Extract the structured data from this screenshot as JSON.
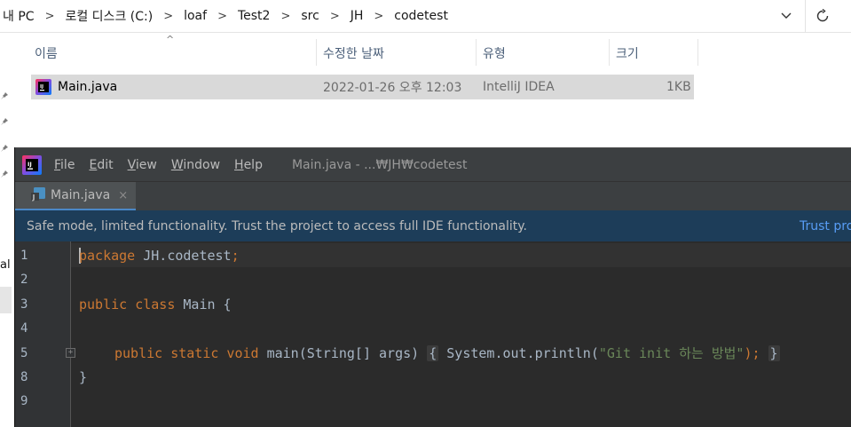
{
  "explorer": {
    "breadcrumbs": [
      "내 PC",
      "로컬 디스크 (C:)",
      "loaf",
      "Test2",
      "src",
      "JH",
      "codetest"
    ],
    "columns": {
      "name": "이름",
      "modified": "수정한 날짜",
      "type": "유형",
      "size": "크기"
    },
    "files": [
      {
        "name": "Main.java",
        "modified": "2022-01-26 오후 12:03",
        "type": "IntelliJ IDEA",
        "size": "1KB"
      }
    ],
    "left_partial_text": "al",
    "icons": {
      "dropdown": "chevron-down-icon",
      "refresh": "refresh-icon",
      "pin": "pin-icon",
      "sort": "sort-up-icon"
    }
  },
  "ide": {
    "menu": {
      "file": {
        "mnemonic": "F",
        "rest": "ile"
      },
      "edit": {
        "mnemonic": "E",
        "rest": "dit"
      },
      "view": {
        "mnemonic": "V",
        "rest": "iew"
      },
      "window": {
        "mnemonic": "W",
        "rest": "indow"
      },
      "help": {
        "mnemonic": "H",
        "rest": "elp"
      }
    },
    "window_title": "Main.java - ...₩JH₩codetest",
    "tab": {
      "label": "Main.java",
      "close": "×"
    },
    "banner": {
      "text": "Safe mode, limited functionality. Trust the project to access full IDE functionality.",
      "link": "Trust pro"
    },
    "editor": {
      "line_numbers": [
        "1",
        "2",
        "3",
        "4",
        "5",
        "8",
        "9"
      ],
      "lines": {
        "l1": {
          "kw": "package",
          "rest": " JH.codetest",
          "semi": ";"
        },
        "l3": {
          "kw": "public class",
          "rest": " Main {"
        },
        "l5": {
          "kw": "public static void",
          "sig": " main(String[] args) ",
          "open": "{",
          "call": " System.out.println(",
          "str": "\"Git init 하는 방법\"",
          "end": ");",
          "close": "}"
        },
        "l8": {
          "text": "}"
        }
      }
    },
    "colors": {
      "keyword": "#cc7832",
      "string": "#6a8759",
      "text": "#a9b7c6",
      "banner_bg": "#1d3d59",
      "link": "#589df6"
    }
  }
}
